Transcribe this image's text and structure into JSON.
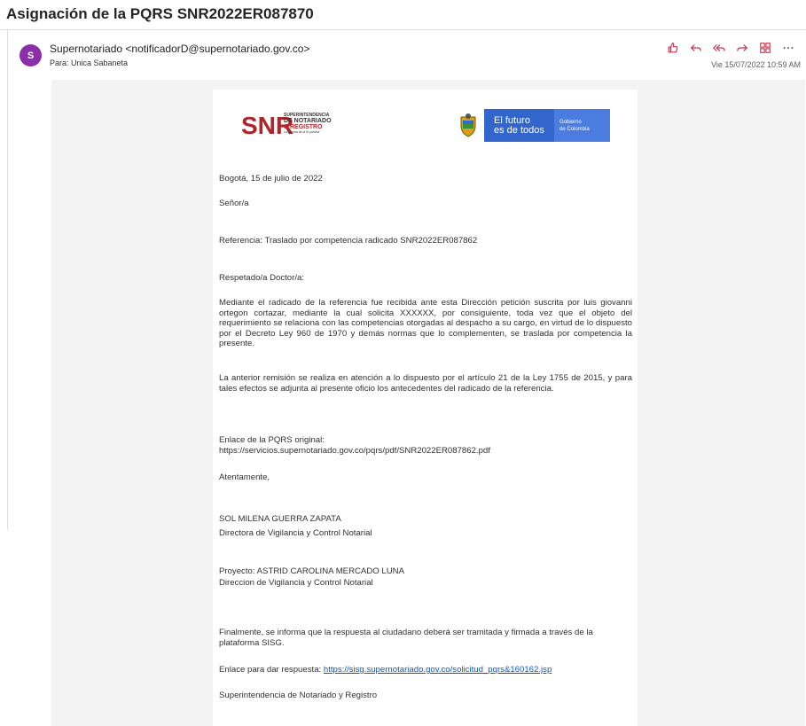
{
  "email": {
    "subject": "Asignación de la PQRS SNR2022ER087870",
    "avatar_initial": "S",
    "sender": "Supernotariado <notificadorD@supernotariado.gov.co>",
    "to": "Para: Unica Sabaneta",
    "date": "Vie 15/07/2022 10:59 AM",
    "actions": [
      "like-icon",
      "reply-icon",
      "reply-all-icon",
      "forward-icon",
      "apps-icon",
      "more-icon"
    ],
    "accent_color": "#8a2fa8"
  },
  "letter": {
    "logo_snr": {
      "mark": "SNR",
      "line1": "SUPERINTENDENCIA",
      "line2": "DE NOTARIADO",
      "line3": "& REGISTRO",
      "line4": "La guarda de la fe pública"
    },
    "logo_gov": {
      "line1": "El futuro",
      "line2": "es de todos",
      "line3": "Gobierno",
      "line4": "de Colombia"
    },
    "date_line": "Bogotá, 15 de julio de 2022",
    "salutation_to": "Señor/a",
    "reference": "Referencia: Traslado por competencia radicado SNR2022ER087862",
    "greeting": "Respetado/a Doctor/a:",
    "paragraph1": "Mediante el radicado de la referencia fue recibida ante esta Dirección petición suscrita por luis giovanni ortegon cortazar, mediante la cual solicita XXXXXX, por consiguiente, toda vez que el objeto del requerimiento se relaciona con las competencias otorgadas al despacho a su cargo, en virtud de lo dispuesto por el Decreto Ley 960 de 1970 y demás normas que lo complementen, se traslada por competencia la presente.",
    "paragraph2": "La anterior remisión se realiza en atención a lo dispuesto por el artículo 21 de la Ley 1755 de 2015, y para tales efectos se adjunta al presente oficio los antecedentes del radicado de la referencia.",
    "original_link_label": "Enlace de la PQRS original:",
    "original_link_url": "https://servicios.supernotariado.gov.co/pqrs/pdf/SNR2022ER087862.pdf",
    "closing": "Atentamente,",
    "signer_name": "SOL MILENA GUERRA ZAPATA",
    "signer_title": "Directora de Vigilancia y Control Notarial",
    "project_name": "Proyecto: ASTRID CAROLINA MERCADO LUNA",
    "project_title": "Direccion de Vigilancia y Control Notarial",
    "final_note": "Finalmente, se informa que la respuesta al ciudadano deberá ser tramitada y firmada a través de la plataforma SISG.",
    "response_label": "Enlace para dar respuesta: ",
    "response_url": "https://sisg.supernotariado.gov.co/solicitud_pqrs&160162.jsp",
    "footer": "Superintendencia de Notariado y Registro"
  }
}
